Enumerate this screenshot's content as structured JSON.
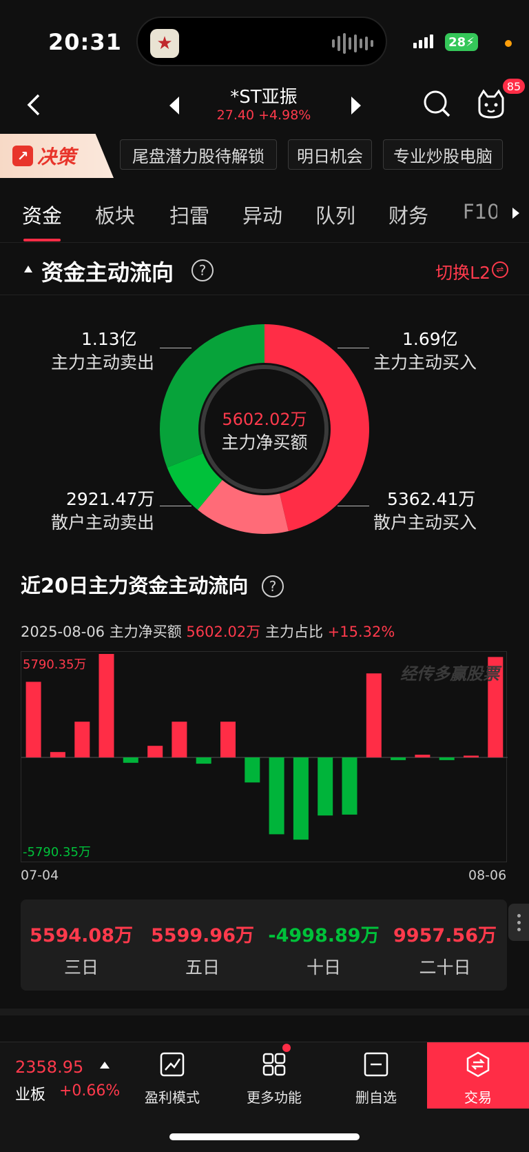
{
  "status": {
    "time": "20:31",
    "battery": "28",
    "colors": {
      "battery": "#35c759",
      "dot": "#ff9f0a"
    }
  },
  "stock": {
    "name": "*ST亚振",
    "price_line": "27.40 +4.98%"
  },
  "nav": {
    "badge_count": "85"
  },
  "promo": {
    "logo_text": "决策",
    "tags": [
      "尾盘潜力股待解锁",
      "明日机会",
      "专业炒股电脑"
    ]
  },
  "tabs": [
    "资金",
    "板块",
    "扫雷",
    "异动",
    "队列",
    "财务",
    "F10"
  ],
  "flow_section": {
    "title": "资金主动流向",
    "switch_label": "切换L2",
    "center_value": "5602.02万",
    "center_label": "主力净买额",
    "main_sell": {
      "value": "1.13亿",
      "label": "主力主动卖出"
    },
    "main_buy": {
      "value": "1.69亿",
      "label": "主力主动买入"
    },
    "retail_sell": {
      "value": "2921.47万",
      "label": "散户主动卖出"
    },
    "retail_buy": {
      "value": "5362.41万",
      "label": "散户主动买入"
    },
    "donut_values": {
      "main_buy": 1.69,
      "retail_buy": 0.536241,
      "retail_sell": 0.292147,
      "main_sell": 1.13
    },
    "colors": {
      "main_buy": "#ff2d46",
      "retail_buy": "#ff6b78",
      "retail_sell": "#00c13a",
      "main_sell": "#07a33a"
    }
  },
  "trend_section": {
    "title": "近20日主力资金主动流向",
    "info_date": "2025-08-06",
    "info_label1": "主力净买额",
    "info_value1": "5602.02万",
    "info_label2": "主力占比",
    "info_value2": "+15.32%",
    "watermark": "经传多赢股票",
    "x_start": "07-04",
    "x_end": "08-06"
  },
  "chart_data": {
    "type": "bar",
    "ymax_label": "5790.35万",
    "ymin_label": "-5790.35万",
    "ylim": [
      -5790.35,
      5790.35
    ],
    "values": [
      4230,
      300,
      2000,
      5790,
      -300,
      650,
      2000,
      -350,
      2000,
      -1400,
      -4300,
      -4600,
      -3250,
      -3200,
      4700,
      -150,
      150,
      -150,
      100,
      5620
    ],
    "colors": {
      "positive": "#ff2d46",
      "negative": "#00b43a"
    }
  },
  "summary": [
    {
      "value": "5594.08万",
      "label": "三日",
      "color": "#ff3a4c"
    },
    {
      "value": "5599.96万",
      "label": "五日",
      "color": "#ff3a4c"
    },
    {
      "value": "-4998.89万",
      "label": "十日",
      "color": "#00c13a"
    },
    {
      "value": "9957.56万",
      "label": "二十日",
      "color": "#ff3a4c"
    }
  ],
  "bottom": {
    "index_value": "2358.95",
    "index_name": "业板",
    "index_change": "+0.66%",
    "items": [
      "盈利模式",
      "更多功能",
      "删自选",
      "交易"
    ]
  }
}
